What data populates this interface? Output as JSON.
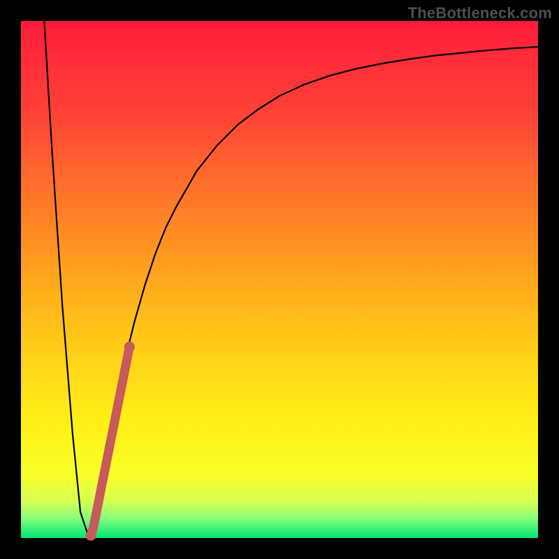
{
  "watermark": "TheBottleneck.com",
  "colors": {
    "background": "#000000",
    "curve": "#000000",
    "highlight": "#c75a5a"
  },
  "chart_data": {
    "type": "line",
    "title": "",
    "xlabel": "",
    "ylabel": "",
    "xlim": [
      0,
      100
    ],
    "ylim": [
      0,
      100
    ],
    "grid": false,
    "legend": false,
    "series": [
      {
        "name": "curve",
        "x": [
          4.5,
          6,
          8,
          10,
          11.5,
          13,
          14,
          15,
          16,
          18,
          20,
          22,
          24,
          26,
          28,
          30,
          34,
          38,
          42,
          46,
          50,
          55,
          60,
          65,
          70,
          75,
          80,
          85,
          90,
          95,
          100
        ],
        "y": [
          100,
          75,
          45,
          20,
          5,
          0.5,
          3,
          8,
          14,
          24,
          34,
          42,
          49,
          55,
          60,
          64,
          71,
          76,
          80,
          83,
          85.5,
          87.8,
          89.5,
          90.8,
          91.8,
          92.6,
          93.3,
          93.8,
          94.3,
          94.7,
          95
        ]
      },
      {
        "name": "highlight",
        "x": [
          13.5,
          14,
          15,
          16,
          18,
          20,
          21
        ],
        "y": [
          0.5,
          2,
          7,
          12,
          22,
          32,
          37
        ]
      }
    ]
  }
}
